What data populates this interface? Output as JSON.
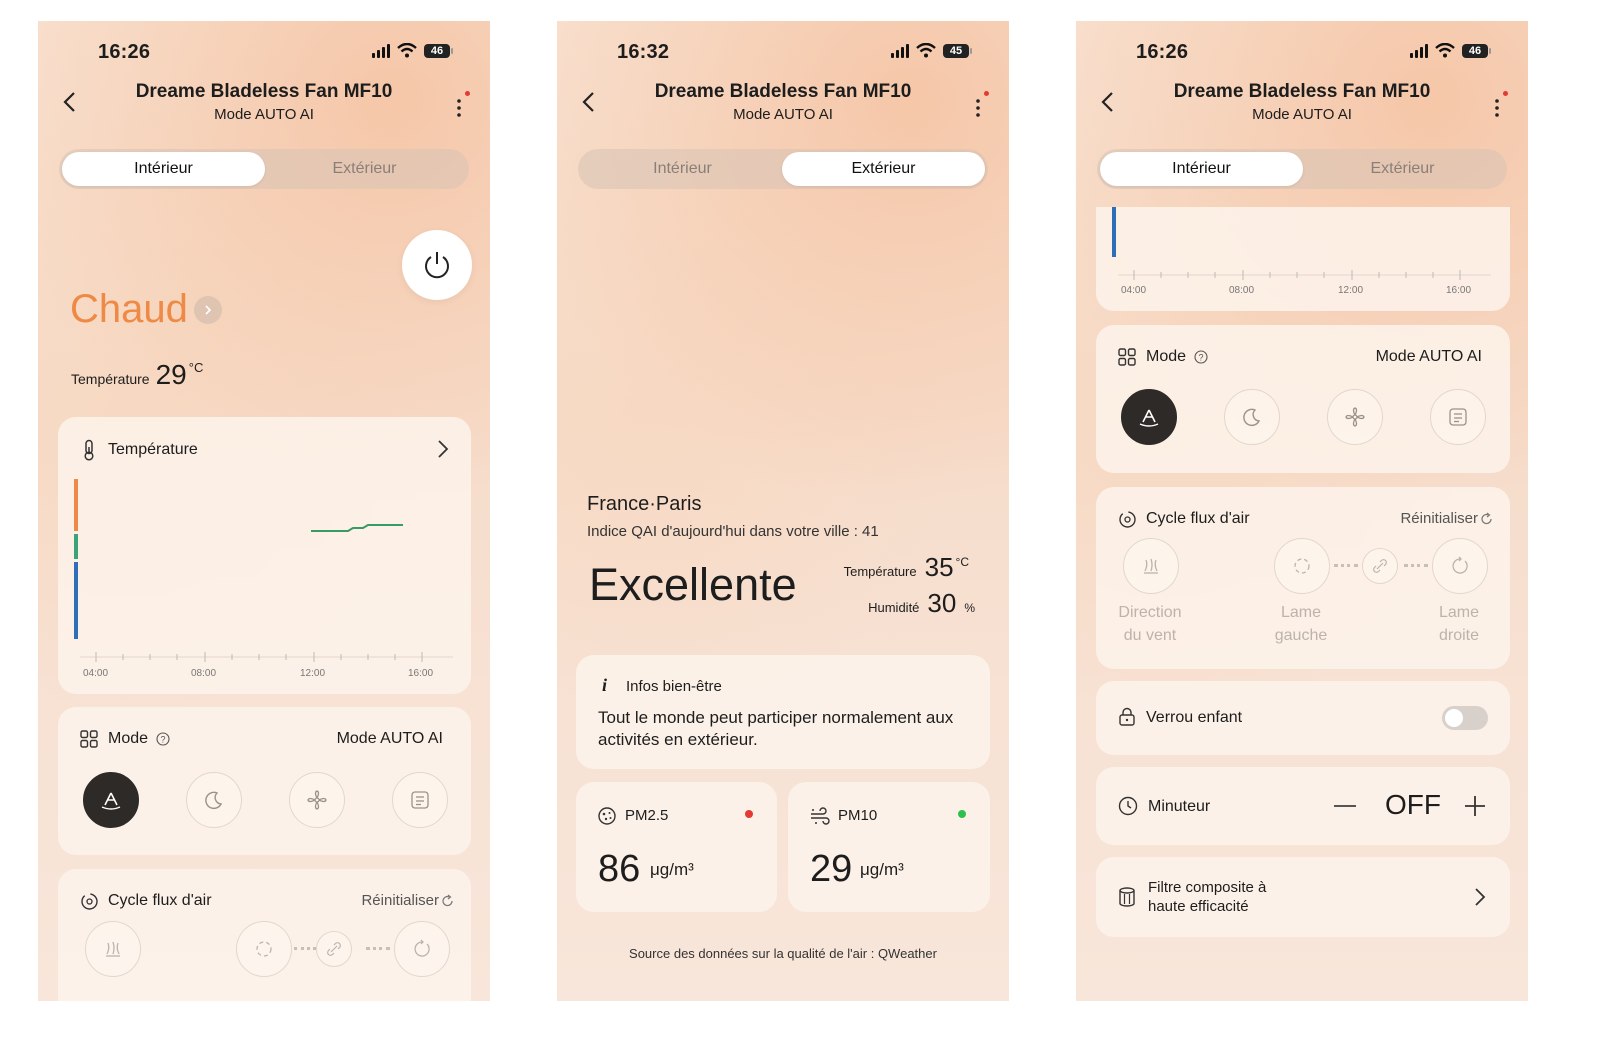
{
  "screens": [
    {
      "status": {
        "time": "16:26",
        "battery": "46"
      },
      "header": {
        "title": "Dreame Bladeless Fan MF10",
        "subtitle": "Mode AUTO AI"
      },
      "tabs": {
        "interior": "Intérieur",
        "exterior": "Extérieur",
        "active": "interior"
      },
      "climate": {
        "state": "Chaud",
        "temp_label": "Température",
        "temp_value": "29",
        "temp_unit": "°C"
      },
      "temp_card": {
        "title": "Température",
        "x_ticks": [
          "04:00",
          "08:00",
          "12:00",
          "16:00"
        ]
      },
      "mode": {
        "label": "Mode",
        "value": "Mode AUTO AI"
      },
      "airflow": {
        "label": "Cycle flux d'air",
        "reset": "Réinitialiser"
      }
    },
    {
      "status": {
        "time": "16:32",
        "battery": "45"
      },
      "header": {
        "title": "Dreame Bladeless Fan MF10",
        "subtitle": "Mode AUTO AI"
      },
      "tabs": {
        "interior": "Intérieur",
        "exterior": "Extérieur",
        "active": "exterior"
      },
      "location": "France·Paris",
      "aqi_text": "Indice QAI d'aujourd'hui dans votre ville : 41",
      "quality": "Excellente",
      "temp_label": "Température",
      "temp_value": "35",
      "temp_unit": "°C",
      "humidity_label": "Humidité",
      "humidity_value": "30",
      "humidity_unit": "%",
      "info": {
        "title": "Infos bien-être",
        "text": "Tout le monde peut participer normalement aux activités en extérieur."
      },
      "pm25": {
        "label": "PM2.5",
        "value": "86",
        "unit": "μg/m³",
        "status_color": "#e53935"
      },
      "pm10": {
        "label": "PM10",
        "value": "29",
        "unit": "μg/m³",
        "status_color": "#2fbf4a"
      },
      "source": "Source des données sur la qualité de l'air : QWeather"
    },
    {
      "status": {
        "time": "16:26",
        "battery": "46"
      },
      "header": {
        "title": "Dreame Bladeless Fan MF10",
        "subtitle": "Mode AUTO AI"
      },
      "tabs": {
        "interior": "Intérieur",
        "exterior": "Extérieur",
        "active": "interior"
      },
      "chart_ticks": [
        "04:00",
        "08:00",
        "12:00",
        "16:00"
      ],
      "mode": {
        "label": "Mode",
        "value": "Mode AUTO AI"
      },
      "airflow": {
        "label": "Cycle flux d'air",
        "reset": "Réinitialiser",
        "items": [
          "Direction du vent",
          "Lame gauche",
          "Lame droite"
        ]
      },
      "child_lock": {
        "label": "Verrou enfant",
        "on": false
      },
      "timer": {
        "label": "Minuteur",
        "value": "OFF"
      },
      "filter": {
        "label": "Filtre composite à haute efficacité"
      }
    }
  ]
}
